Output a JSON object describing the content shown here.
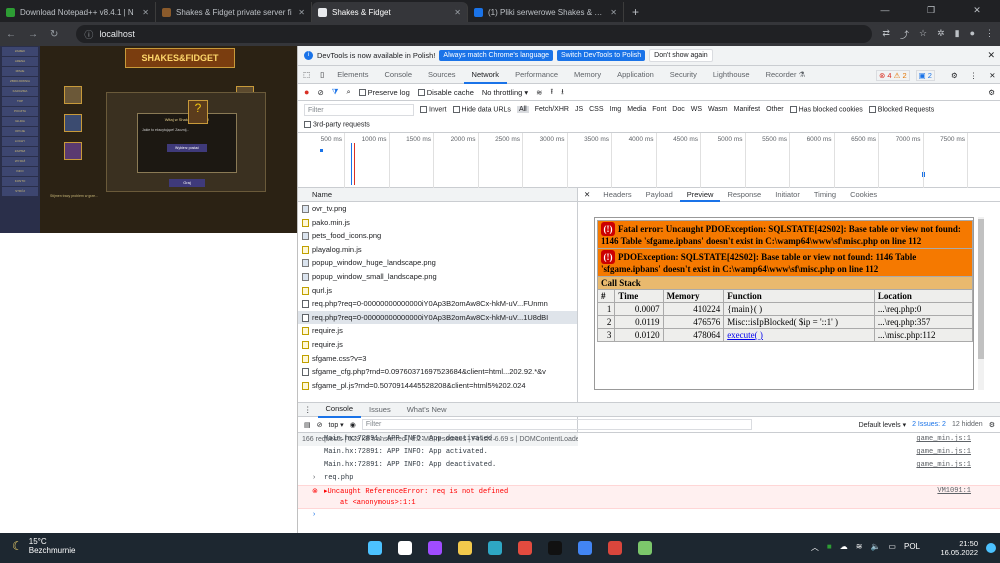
{
  "browser": {
    "tabs": [
      {
        "title": "Download Notepad++ v8.4.1 | N",
        "color": "#2d9d34"
      },
      {
        "title": "Shakes & Fidget private server fi",
        "color": "#8a5a2b"
      },
      {
        "title": "Shakes & Fidget",
        "color": "#e8eaed",
        "active": true
      },
      {
        "title": "(1) Pliki serwerowe Shakes & Fidg",
        "color": "#1a73e8"
      }
    ],
    "url": "localhost",
    "window_controls": [
      "—",
      "❐",
      "✕"
    ]
  },
  "game": {
    "logo": "SHAKES&FIDGET",
    "menu": [
      "ZAMEK",
      "ARENA",
      "MISJE",
      "ZBROJOWNIA",
      "KARCZMA",
      "TOP",
      "POCZTA",
      "GILDIA",
      "OPCJE",
      "LOCHY",
      "ZAPISZ",
      "WYJDŹ",
      "INFO",
      "KONTO",
      "STRÓJ"
    ],
    "dialog_title": "Witaj w Shakes & Fidget!",
    "dialog_text": "Jakie to ekscytujące! Zacznij...",
    "dialog_button": "Wybierz postać",
    "dialog_ok": "Graj",
    "footer_text": "Stijmen tracy problem w grze..."
  },
  "devtools": {
    "infobar": {
      "text": "DevTools is now available in Polish!",
      "btn1": "Always match Chrome's language",
      "btn2": "Switch DevTools to Polish",
      "btn3": "Don't show again"
    },
    "tabs": [
      "Elements",
      "Console",
      "Sources",
      "Network",
      "Performance",
      "Memory",
      "Application",
      "Security",
      "Lighthouse",
      "Recorder ⚗"
    ],
    "active_tab": "Network",
    "badges": {
      "errors": "4",
      "warnings": "2",
      "info": "2"
    },
    "toolbar": {
      "preserve_log": "Preserve log",
      "disable_cache": "Disable cache",
      "throttling": "No throttling"
    },
    "filter": {
      "placeholder": "Filter",
      "invert": "Invert",
      "hide_data_urls": "Hide data URLs",
      "types": [
        "All",
        "Fetch/XHR",
        "JS",
        "CSS",
        "Img",
        "Media",
        "Font",
        "Doc",
        "WS",
        "Wasm",
        "Manifest",
        "Other"
      ],
      "blocked_cookies": "Has blocked cookies",
      "blocked_requests": "Blocked Requests",
      "third_party": "3rd-party requests"
    },
    "timeline_ticks": [
      "500 ms",
      "1000 ms",
      "1500 ms",
      "2000 ms",
      "2500 ms",
      "3000 ms",
      "3500 ms",
      "4000 ms",
      "4500 ms",
      "5000 ms",
      "5500 ms",
      "6000 ms",
      "6500 ms",
      "7000 ms",
      "7500 ms"
    ],
    "requests_header": "Name",
    "requests": [
      {
        "name": "ovr_tv.png",
        "type": "img"
      },
      {
        "name": "pako.min.js",
        "type": "js"
      },
      {
        "name": "pets_food_icons.png",
        "type": "img"
      },
      {
        "name": "playalog.min.js",
        "type": "js"
      },
      {
        "name": "popup_window_huge_landscape.png",
        "type": "img"
      },
      {
        "name": "popup_window_small_landscape.png",
        "type": "img"
      },
      {
        "name": "qurl.js",
        "type": "js"
      },
      {
        "name": "req.php?req=0-00000000000000iY0Ap3B2omAw8Cx-hkM-uV...FUnmn",
        "type": "doc"
      },
      {
        "name": "req.php?req=0-00000000000000iY0Ap3B2omAw8Cx-hkM-uV...1U8dBI",
        "type": "doc",
        "selected": true
      },
      {
        "name": "require.js",
        "type": "js"
      },
      {
        "name": "require.js",
        "type": "js"
      },
      {
        "name": "sfgame.css?v=3",
        "type": "js"
      },
      {
        "name": "sfgame_cfg.php?rnd=0.09760371697523684&client=html...202.92.*&v",
        "type": "doc"
      },
      {
        "name": "sfgame_pl.js?rnd=0.5070914445528208&client=html5%202.024",
        "type": "js"
      }
    ],
    "status": "166 requests | 529 kB transferred | 8.2 MB resources | Finish: 6.69 s | DOMContentLoaded",
    "detail_tabs": [
      "Headers",
      "Payload",
      "Preview",
      "Response",
      "Initiator",
      "Timing",
      "Cookies"
    ],
    "active_detail_tab": "Preview",
    "preview": {
      "fatal": "Fatal error: Uncaught PDOException: SQLSTATE[42S02]: Base table or view not found: 1146 Table 'sfgame.ipbans' doesn't exist in C:\\wamp64\\www\\sf\\misc.php on line 112",
      "pdo": "PDOException: SQLSTATE[42S02]: Base table or view not found: 1146 Table 'sfgame.ipbans' doesn't exist in C:\\wamp64\\www\\sf\\misc.php on line 112",
      "callstack": "Call Stack",
      "cols": [
        "#",
        "Time",
        "Memory",
        "Function",
        "Location"
      ],
      "rows": [
        {
          "n": "1",
          "time": "0.0007",
          "mem": "410224",
          "fn": "{main}( )",
          "loc": "...\\req.php:0"
        },
        {
          "n": "2",
          "time": "0.0119",
          "mem": "476576",
          "fn": "Misc::isIpBlocked( $ip = '::1' )",
          "loc": "...\\req.php:357"
        },
        {
          "n": "3",
          "time": "0.0120",
          "mem": "478064",
          "fn": "execute( )",
          "loc": "...\\misc.php:112"
        }
      ]
    },
    "drawer_tabs": [
      "Console",
      "Issues",
      "What's New"
    ],
    "console_toolbar": {
      "context": "top",
      "filter": "Filter",
      "levels": "Default levels",
      "issues": "2 Issues: 2",
      "hidden": "12 hidden"
    },
    "console_logs": [
      {
        "text": "Main.hx:72891: APP INFO: App deactivated.",
        "src": "game_min.js:1"
      },
      {
        "text": "Main.hx:72891: APP INFO: App activated.",
        "src": "game_min.js:1"
      },
      {
        "text": "Main.hx:72891: APP INFO: App deactivated.",
        "src": "game_min.js:1"
      }
    ],
    "console_input": "req.php",
    "console_error": "Uncaught ReferenceError: req is not defined",
    "console_error_at": "at <anonymous>:1:1",
    "console_error_src": "VM1091:1"
  },
  "taskbar": {
    "temp": "15°C",
    "weather": "Bezchmurnie",
    "time": "21:50",
    "date": "16.05.2022",
    "lang": "POL",
    "icons": [
      {
        "name": "windows-icon",
        "color": "#4cc2ff"
      },
      {
        "name": "search-icon",
        "color": "#ffffff"
      },
      {
        "name": "messenger-icon",
        "color": "#a04cff"
      },
      {
        "name": "files-icon",
        "color": "#f2c94c"
      },
      {
        "name": "edge-icon",
        "color": "#2ea7c4"
      },
      {
        "name": "chrome-icon",
        "color": "#e34b3f"
      },
      {
        "name": "tiktok-icon",
        "color": "#111111"
      },
      {
        "name": "chrome-active-icon",
        "color": "#4285f4"
      },
      {
        "name": "app-icon",
        "color": "#d9463c"
      },
      {
        "name": "notepad-icon",
        "color": "#7cc76b"
      }
    ]
  }
}
